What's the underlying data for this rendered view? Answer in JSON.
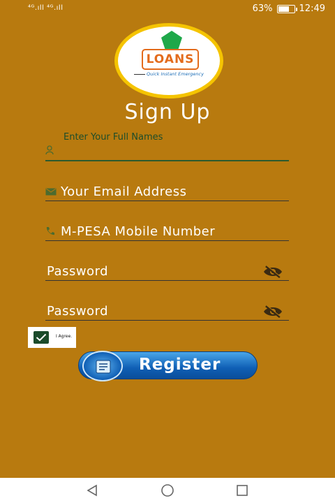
{
  "status_bar": {
    "signal_left": "⁴ᴳ.ıll ⁴ᴳ.ıll",
    "battery": "63%",
    "battery_level": 0.63,
    "time": "12:49"
  },
  "logo": {
    "text": "LOANS",
    "tagline": "Quick Instant Emergency"
  },
  "title": "Sign Up",
  "form": {
    "full_name": {
      "hint": "Enter Your Full Names",
      "value": ""
    },
    "email": {
      "placeholder": "Your Email Address"
    },
    "mobile": {
      "placeholder": "M-PESA Mobile Number"
    },
    "password": {
      "placeholder": "Password"
    },
    "confirm_password": {
      "placeholder": "Password"
    },
    "agree": {
      "label": "I Agree.",
      "checked": true
    }
  },
  "register_button": {
    "label": "Register"
  },
  "icons": {
    "person": "person-icon",
    "email": "email-icon",
    "phone": "phone-icon",
    "eye": "eye-off-icon"
  },
  "colors": {
    "background": "#B87A0F",
    "accent": "#0F5FB5",
    "field_icon": "#4C6B2E"
  }
}
